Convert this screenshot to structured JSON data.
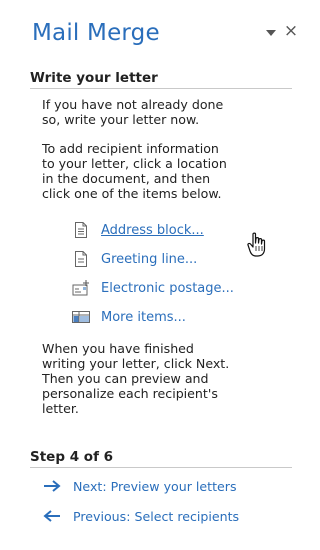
{
  "pane": {
    "title": "Mail Merge",
    "close_glyph": "×",
    "dropdown_icon": "chevron-down-icon",
    "close_icon": "close-icon"
  },
  "section1": {
    "heading": "Write your letter",
    "intro": "If you have not already done\nso, write your letter now.",
    "instructions": "To add recipient information\nto your letter, click a location\nin the document, and then\nclick one of the items below.",
    "items": [
      {
        "label": "Address block...",
        "icon": "address-block-icon"
      },
      {
        "label": "Greeting line...",
        "icon": "greeting-line-icon"
      },
      {
        "label": "Electronic postage...",
        "icon": "electronic-postage-icon"
      },
      {
        "label": "More items...",
        "icon": "more-items-icon"
      }
    ],
    "outro": "When you have finished\nwriting your letter, click Next.\nThen you can preview and\npersonalize each recipient's\nletter."
  },
  "step": {
    "heading": "Step 4 of 6",
    "next": {
      "label": "Next: Preview your letters",
      "icon": "arrow-right-icon"
    },
    "previous": {
      "label": "Previous: Select recipients",
      "icon": "arrow-left-icon"
    }
  },
  "colors": {
    "accent": "#2a6ebb",
    "text": "#222222",
    "divider": "#c9c9c9"
  }
}
